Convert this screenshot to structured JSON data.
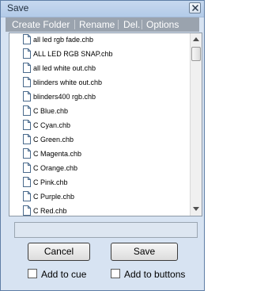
{
  "window": {
    "title": "Save"
  },
  "menu": {
    "create_folder": "Create Folder",
    "rename": "Rename",
    "delete": "Del.",
    "options": "Options"
  },
  "files": [
    "all led rgb fade.chb",
    "ALL LED RGB SNAP.chb",
    "all led white out.chb",
    "blinders white out.chb",
    "blinders400 rgb.chb",
    "C Blue.chb",
    "C Cyan.chb",
    "C Green.chb",
    "C Magenta.chb",
    "C Orange.chb",
    "C Pink.chb",
    "C Purple.chb",
    "C Red.chb"
  ],
  "filename_input": {
    "value": ""
  },
  "buttons": {
    "cancel": "Cancel",
    "save": "Save"
  },
  "checkboxes": {
    "add_to_cue": "Add to cue",
    "add_to_buttons": "Add to buttons"
  }
}
